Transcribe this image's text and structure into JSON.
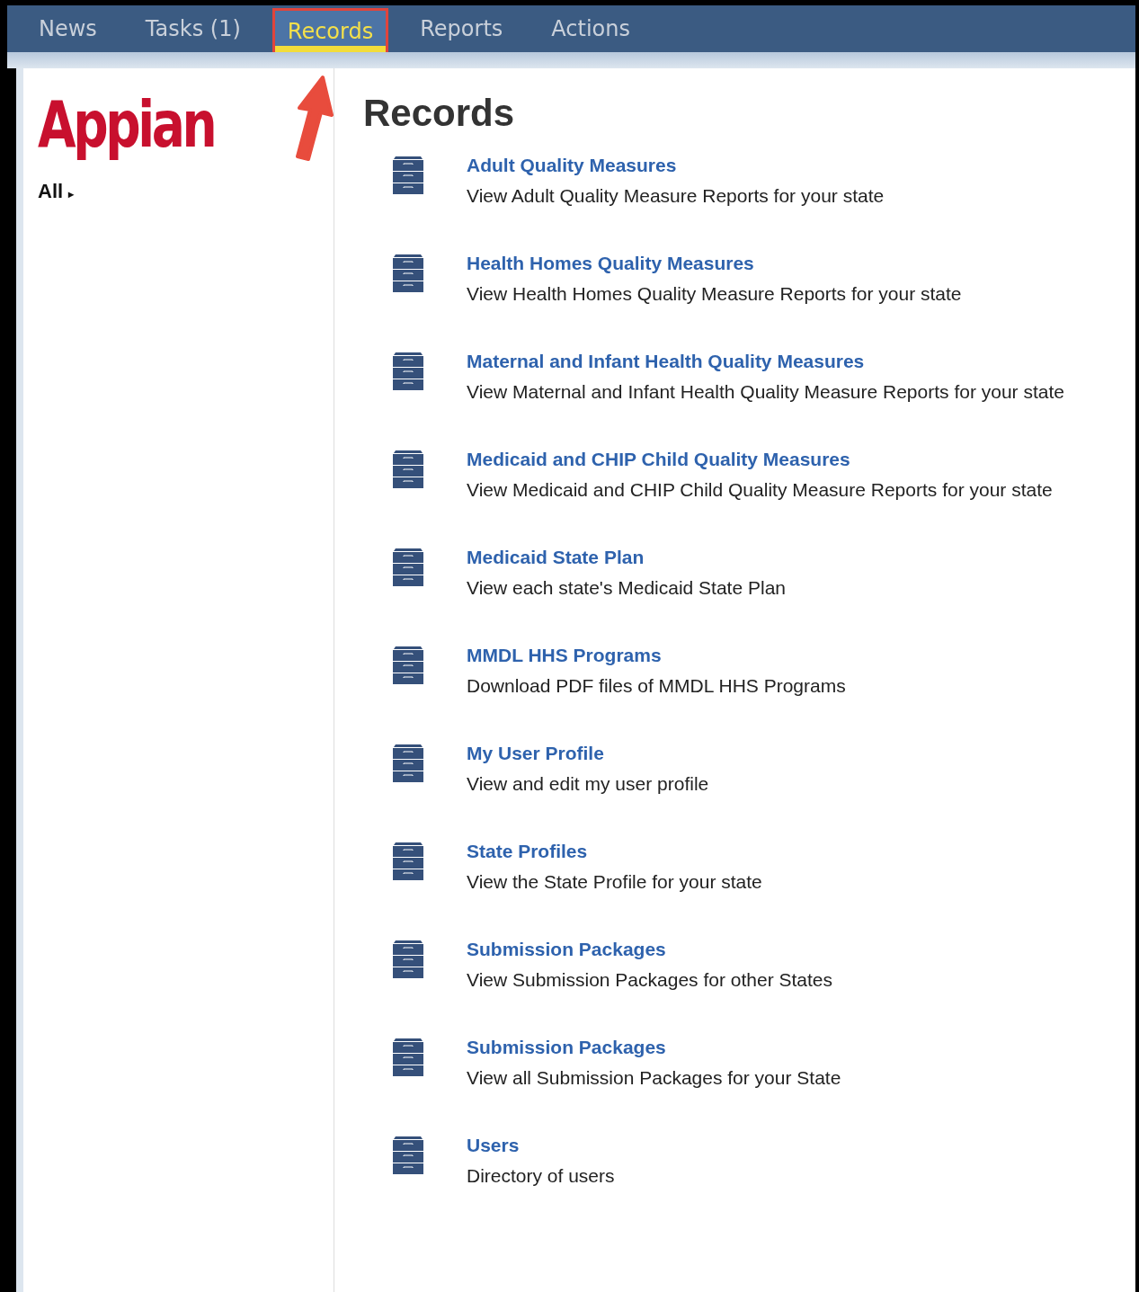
{
  "nav": {
    "tabs": [
      {
        "label": "News",
        "selected": false
      },
      {
        "label": "Tasks (1)",
        "selected": false
      },
      {
        "label": "Records",
        "selected": true
      },
      {
        "label": "Reports",
        "selected": false
      },
      {
        "label": "Actions",
        "selected": false
      }
    ]
  },
  "sidebar": {
    "logo": "Appian",
    "filter": "All",
    "filter_caret": "▸"
  },
  "main": {
    "title": "Records",
    "records": [
      {
        "title": "Adult Quality Measures",
        "description": "View Adult Quality Measure Reports for your state"
      },
      {
        "title": "Health Homes Quality Measures",
        "description": "View Health Homes Quality Measure Reports for your state"
      },
      {
        "title": "Maternal and Infant Health Quality Measures",
        "description": "View Maternal and Infant Health Quality Measure Reports for your state"
      },
      {
        "title": "Medicaid and CHIP Child Quality Measures",
        "description": "View Medicaid and CHIP Child Quality Measure Reports for your state"
      },
      {
        "title": "Medicaid State Plan",
        "description": "View each state's Medicaid State Plan"
      },
      {
        "title": "MMDL HHS Programs",
        "description": "Download PDF files of MMDL HHS Programs"
      },
      {
        "title": "My User Profile",
        "description": "View and edit my user profile"
      },
      {
        "title": "State Profiles",
        "description": "View the State Profile for your state"
      },
      {
        "title": "Submission Packages",
        "description": "View Submission Packages for other States"
      },
      {
        "title": "Submission Packages",
        "description": "View all Submission Packages for your State"
      },
      {
        "title": "Users",
        "description": "Directory of users"
      }
    ]
  }
}
